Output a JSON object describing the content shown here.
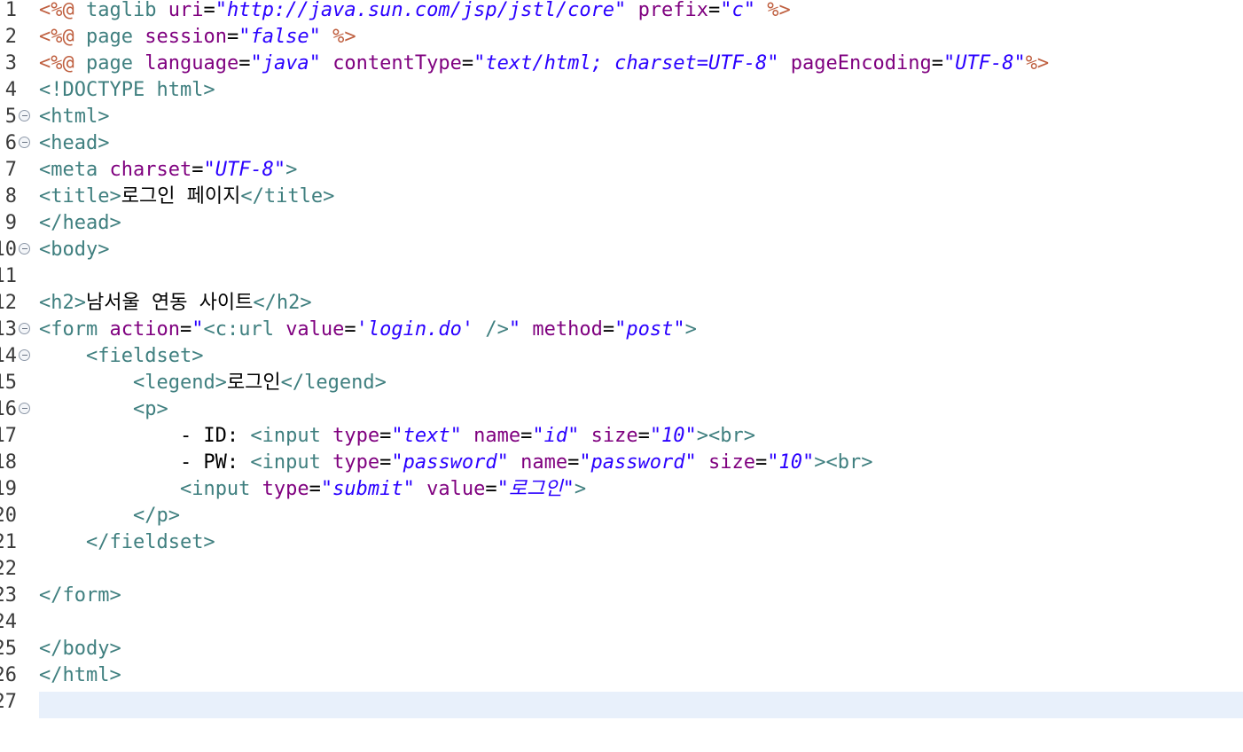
{
  "line_numbers": [
    "1",
    "2",
    "3",
    "4",
    "5",
    "6",
    "7",
    "8",
    "9",
    "10",
    "11",
    "12",
    "13",
    "14",
    "15",
    "16",
    "17",
    "18",
    "19",
    "20",
    "21",
    "22",
    "23",
    "24",
    "25",
    "26",
    "27"
  ],
  "folded_lines": [
    "5",
    "6",
    "10",
    "13",
    "14",
    "16"
  ],
  "colors": {
    "tag": "#3f7f7f",
    "attribute": "#7f007f",
    "value": "#2a00ff",
    "directive": "#bf5f3f",
    "current_line": "#e8f0fb"
  },
  "lines": [
    [
      [
        "d",
        "<%@"
      ],
      [
        "t",
        " taglib "
      ],
      [
        "a",
        "uri"
      ],
      [
        "p",
        "="
      ],
      [
        "v",
        "\"http://java.sun.com/jsp/jstl/core\""
      ],
      [
        "p",
        " "
      ],
      [
        "a",
        "prefix"
      ],
      [
        "p",
        "="
      ],
      [
        "v",
        "\"c\""
      ],
      [
        "p",
        " "
      ],
      [
        "d",
        "%>"
      ]
    ],
    [
      [
        "d",
        "<%@"
      ],
      [
        "t",
        " page "
      ],
      [
        "a",
        "session"
      ],
      [
        "p",
        "="
      ],
      [
        "v",
        "\"false\""
      ],
      [
        "p",
        " "
      ],
      [
        "d",
        "%>"
      ]
    ],
    [
      [
        "d",
        "<%@"
      ],
      [
        "t",
        " page "
      ],
      [
        "a",
        "language"
      ],
      [
        "p",
        "="
      ],
      [
        "v",
        "\"java\""
      ],
      [
        "p",
        " "
      ],
      [
        "a",
        "contentType"
      ],
      [
        "p",
        "="
      ],
      [
        "v",
        "\"text/html; charset=UTF-8\""
      ],
      [
        "p",
        " "
      ],
      [
        "a",
        "pageEncoding"
      ],
      [
        "p",
        "="
      ],
      [
        "v",
        "\"UTF-8\""
      ],
      [
        "d",
        "%>"
      ]
    ],
    [
      [
        "t",
        "<!DOCTYPE html>"
      ]
    ],
    [
      [
        "t",
        "<html>"
      ]
    ],
    [
      [
        "t",
        "<head>"
      ]
    ],
    [
      [
        "t",
        "<meta "
      ],
      [
        "a",
        "charset"
      ],
      [
        "p",
        "="
      ],
      [
        "v",
        "\"UTF-8\""
      ],
      [
        "t",
        ">"
      ]
    ],
    [
      [
        "t",
        "<title>"
      ],
      [
        "p",
        "로그인 페이지"
      ],
      [
        "t",
        "</title>"
      ]
    ],
    [
      [
        "t",
        "</head>"
      ]
    ],
    [
      [
        "t",
        "<body>"
      ]
    ],
    [],
    [
      [
        "t",
        "<h2>"
      ],
      [
        "p",
        "남서울 연동 사이트"
      ],
      [
        "t",
        "</h2>"
      ]
    ],
    [
      [
        "t",
        "<form "
      ],
      [
        "a",
        "action"
      ],
      [
        "p",
        "="
      ],
      [
        "v",
        "\""
      ],
      [
        "t",
        "<c:url "
      ],
      [
        "a",
        "value"
      ],
      [
        "p",
        "="
      ],
      [
        "v",
        "'login.do'"
      ],
      [
        "p",
        " "
      ],
      [
        "t",
        "/>"
      ],
      [
        "v",
        "\""
      ],
      [
        "p",
        " "
      ],
      [
        "a",
        "method"
      ],
      [
        "p",
        "="
      ],
      [
        "v",
        "\"post\""
      ],
      [
        "t",
        ">"
      ]
    ],
    [
      [
        "p",
        "    "
      ],
      [
        "t",
        "<fieldset>"
      ]
    ],
    [
      [
        "p",
        "        "
      ],
      [
        "t",
        "<legend>"
      ],
      [
        "p",
        "로그인"
      ],
      [
        "t",
        "</legend>"
      ]
    ],
    [
      [
        "p",
        "        "
      ],
      [
        "t",
        "<p>"
      ]
    ],
    [
      [
        "p",
        "            - ID: "
      ],
      [
        "t",
        "<input "
      ],
      [
        "a",
        "type"
      ],
      [
        "p",
        "="
      ],
      [
        "v",
        "\"text\""
      ],
      [
        "p",
        " "
      ],
      [
        "a",
        "name"
      ],
      [
        "p",
        "="
      ],
      [
        "v",
        "\"id\""
      ],
      [
        "p",
        " "
      ],
      [
        "a",
        "size"
      ],
      [
        "p",
        "="
      ],
      [
        "v",
        "\"10\""
      ],
      [
        "t",
        "><br>"
      ]
    ],
    [
      [
        "p",
        "            - PW: "
      ],
      [
        "t",
        "<input "
      ],
      [
        "a",
        "type"
      ],
      [
        "p",
        "="
      ],
      [
        "v",
        "\"password\""
      ],
      [
        "p",
        " "
      ],
      [
        "a",
        "name"
      ],
      [
        "p",
        "="
      ],
      [
        "v",
        "\"password\""
      ],
      [
        "p",
        " "
      ],
      [
        "a",
        "size"
      ],
      [
        "p",
        "="
      ],
      [
        "v",
        "\"10\""
      ],
      [
        "t",
        "><br>"
      ]
    ],
    [
      [
        "p",
        "            "
      ],
      [
        "t",
        "<input "
      ],
      [
        "a",
        "type"
      ],
      [
        "p",
        "="
      ],
      [
        "v",
        "\"submit\""
      ],
      [
        "p",
        " "
      ],
      [
        "a",
        "value"
      ],
      [
        "p",
        "="
      ],
      [
        "v",
        "\"로그인\""
      ],
      [
        "t",
        ">"
      ]
    ],
    [
      [
        "p",
        "        "
      ],
      [
        "t",
        "</p>"
      ]
    ],
    [
      [
        "p",
        "    "
      ],
      [
        "t",
        "</fieldset>"
      ]
    ],
    [],
    [
      [
        "t",
        "</form>"
      ]
    ],
    [],
    [
      [
        "t",
        "</body>"
      ]
    ],
    [
      [
        "t",
        "</html>"
      ]
    ],
    []
  ]
}
